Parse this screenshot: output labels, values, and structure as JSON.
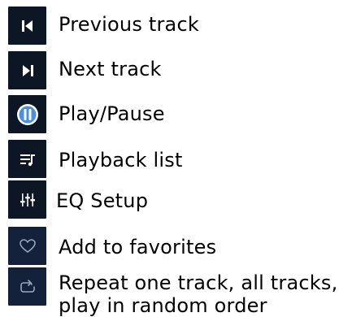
{
  "legend": {
    "items": [
      {
        "icon": "previous-track-icon",
        "label": "Previous track"
      },
      {
        "icon": "next-track-icon",
        "label": "Next track"
      },
      {
        "icon": "play-pause-icon",
        "label": "Play/Pause"
      },
      {
        "icon": "playback-list-icon",
        "label": "Playback list"
      },
      {
        "icon": "eq-setup-icon",
        "label": "EQ Setup"
      },
      {
        "icon": "heart-icon",
        "label": "Add to favorites"
      },
      {
        "icon": "repeat-icon",
        "label": "Repeat one track, all tracks,",
        "label_line2": "play in random order"
      }
    ]
  },
  "colors": {
    "tile_dark": "#0c1625",
    "icon_white": "#ffffff",
    "play_blue": "#4a8fe0",
    "outline_gray": "#9aa6b8"
  }
}
